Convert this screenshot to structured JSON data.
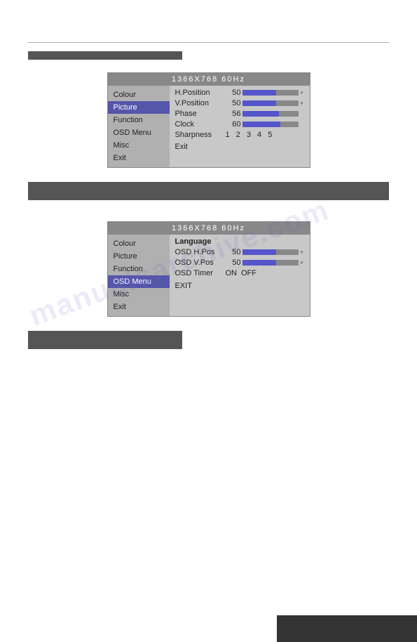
{
  "page": {
    "background": "#ffffff"
  },
  "divider1": {},
  "section1": {
    "header_label": ""
  },
  "panel1": {
    "title": "1366X768    60Hz",
    "menu_items": [
      {
        "label": "Colour",
        "active": false
      },
      {
        "label": "Picture",
        "active": true
      },
      {
        "label": "Function",
        "active": false
      },
      {
        "label": "OSD Menu",
        "active": false
      },
      {
        "label": "Misc",
        "active": false
      },
      {
        "label": "Exit",
        "active": false
      }
    ],
    "rows": [
      {
        "label": "H.Position",
        "value": "50",
        "fill_pct": 60
      },
      {
        "label": "V.Position",
        "value": "50",
        "fill_pct": 60
      },
      {
        "label": "Phase",
        "value": "56",
        "fill_pct": 65
      },
      {
        "label": "Clock",
        "value": "60",
        "fill_pct": 68
      }
    ],
    "sharpness_label": "Sharpness",
    "sharpness_nums": "1 2 3 4 5",
    "exit_label": "Exit"
  },
  "section2": {
    "header_label": ""
  },
  "panel2": {
    "title": "1366X768    60Hz",
    "menu_items": [
      {
        "label": "Colour",
        "active": false
      },
      {
        "label": "Picture",
        "active": false
      },
      {
        "label": "Function",
        "active": false
      },
      {
        "label": "OSD Menu",
        "active": true
      },
      {
        "label": "Misc",
        "active": false
      },
      {
        "label": "Exit",
        "active": false
      }
    ],
    "language_label": "Language",
    "rows": [
      {
        "label": "OSD H.Pos",
        "value": "50",
        "fill_pct": 60
      },
      {
        "label": "OSD V.Pos",
        "value": "50",
        "fill_pct": 60
      }
    ],
    "timer_label": "OSD Timer",
    "on_label": "ON",
    "off_label": "OFF",
    "exit_label": "EXIT"
  },
  "section3": {
    "header_label": ""
  },
  "watermark": "manualsarchive.com"
}
